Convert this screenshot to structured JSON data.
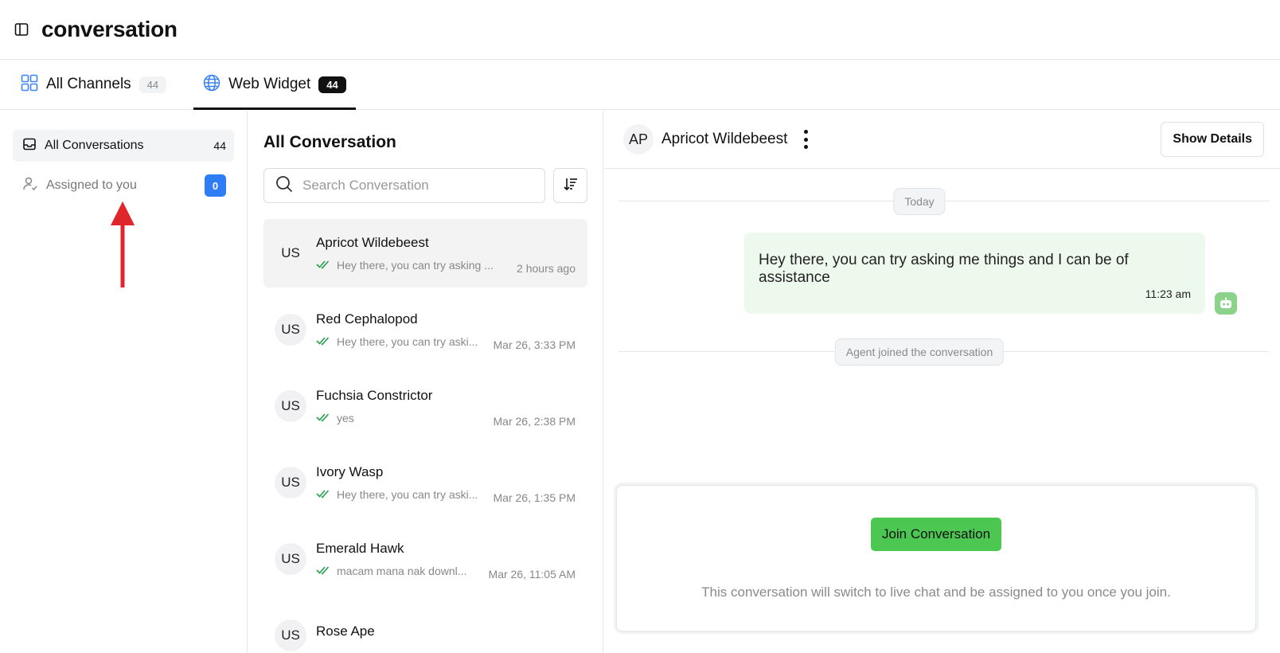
{
  "header": {
    "title": "conversation",
    "sidebar_toggle_icon": "sidebar-toggle-icon"
  },
  "tabs": [
    {
      "label": "All Channels",
      "count": "44",
      "icon": "grid-icon",
      "active": false
    },
    {
      "label": "Web Widget",
      "count": "44",
      "icon": "globe-icon",
      "active": true
    }
  ],
  "sidebar": {
    "items": [
      {
        "label": "All Conversations",
        "count": "44",
        "icon": "inbox-icon"
      },
      {
        "label": "Assigned to you",
        "count": "0",
        "icon": "user-check-icon"
      }
    ],
    "annotation_color": "#e0262b"
  },
  "list": {
    "title": "All Conversation",
    "search_placeholder": "Search Conversation",
    "conversations": [
      {
        "initials": "US",
        "name": "Apricot Wildebeest",
        "preview": "Hey there, you can try asking ...",
        "time": "2 hours ago"
      },
      {
        "initials": "US",
        "name": "Red Cephalopod",
        "preview": "Hey there, you can try aski...",
        "time": "Mar 26, 3:33 PM"
      },
      {
        "initials": "US",
        "name": "Fuchsia Constrictor",
        "preview": "yes",
        "time": "Mar 26, 2:38 PM"
      },
      {
        "initials": "US",
        "name": "Ivory Wasp",
        "preview": "Hey there, you can try aski...",
        "time": "Mar 26, 1:35 PM"
      },
      {
        "initials": "US",
        "name": "Emerald Hawk",
        "preview": "macam mana nak downl...",
        "time": "Mar 26, 11:05 AM"
      },
      {
        "initials": "US",
        "name": "Rose Ape",
        "preview": "",
        "time": ""
      }
    ]
  },
  "chat": {
    "avatar": "AP",
    "name": "Apricot Wildebeest",
    "show_details": "Show Details",
    "day_label": "Today",
    "message": {
      "text": "Hey there, you can try asking me things and I can be of assistance",
      "time": "11:23 am"
    },
    "event_label": "Agent joined the conversation",
    "join_button": "Join Conversation",
    "join_note": "This conversation will switch to live chat and be assigned to you once you join."
  },
  "colors": {
    "accent_blue": "#2f7df6",
    "join_green": "#4cc752",
    "bubble_bg": "#eef9ee",
    "check_green": "#22a04b"
  }
}
